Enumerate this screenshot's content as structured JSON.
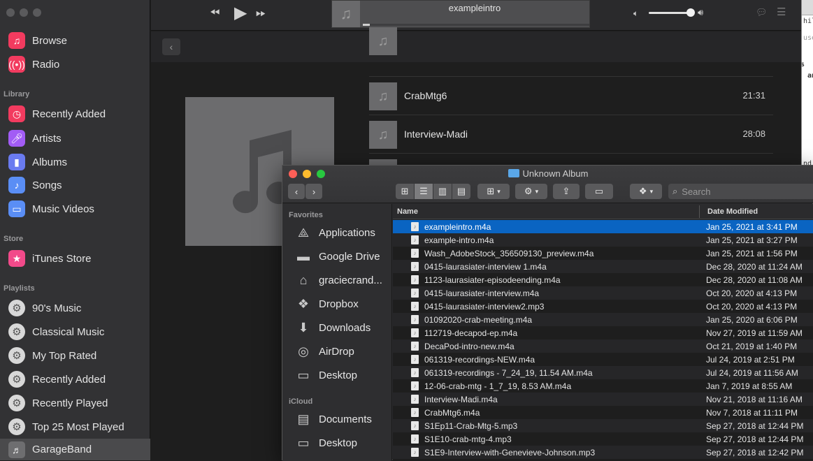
{
  "music": {
    "sidebar": {
      "top_items": [
        {
          "label": "Browse",
          "icon": "music-note-icon"
        },
        {
          "label": "Radio",
          "icon": "radio-waves-icon"
        }
      ],
      "library_heading": "Library",
      "library_items": [
        {
          "label": "Recently Added",
          "icon": "clock-icon"
        },
        {
          "label": "Artists",
          "icon": "microphone-icon"
        },
        {
          "label": "Albums",
          "icon": "album-stack-icon"
        },
        {
          "label": "Songs",
          "icon": "music-note-icon"
        },
        {
          "label": "Music Videos",
          "icon": "video-icon"
        }
      ],
      "store_heading": "Store",
      "store_items": [
        {
          "label": "iTunes Store",
          "icon": "star-icon"
        }
      ],
      "playlists_heading": "Playlists",
      "playlist_items": [
        {
          "label": "90's Music",
          "icon": "smart-playlist-gear-icon"
        },
        {
          "label": "Classical Music",
          "icon": "smart-playlist-gear-icon"
        },
        {
          "label": "My Top Rated",
          "icon": "smart-playlist-gear-icon"
        },
        {
          "label": "Recently Added",
          "icon": "smart-playlist-gear-icon"
        },
        {
          "label": "Recently Played",
          "icon": "smart-playlist-gear-icon"
        },
        {
          "label": "Top 25 Most Played",
          "icon": "smart-playlist-gear-icon"
        },
        {
          "label": "GarageBand",
          "icon": "playlist-icon",
          "selected": true
        }
      ]
    },
    "now_playing": {
      "title": "exampleintro",
      "progress": 0.03
    },
    "volume": 0.9,
    "tracks": [
      {
        "name": "CrabMtg6",
        "time": "21:31"
      },
      {
        "name": "Interview-Madi",
        "time": "28:08"
      }
    ]
  },
  "finder": {
    "title": "Unknown Album",
    "search_placeholder": "Search",
    "favorites_heading": "Favorites",
    "favorites": [
      {
        "label": "Applications",
        "icon": "applications-icon"
      },
      {
        "label": "Google Drive",
        "icon": "folder-icon"
      },
      {
        "label": "graciecrand...",
        "icon": "home-icon"
      },
      {
        "label": "Dropbox",
        "icon": "dropbox-icon"
      },
      {
        "label": "Downloads",
        "icon": "downloads-icon"
      },
      {
        "label": "AirDrop",
        "icon": "airdrop-icon"
      },
      {
        "label": "Desktop",
        "icon": "desktop-icon"
      }
    ],
    "icloud_heading": "iCloud",
    "icloud": [
      {
        "label": "Documents",
        "icon": "documents-icon"
      },
      {
        "label": "Desktop",
        "icon": "desktop-icon"
      }
    ],
    "columns": {
      "name": "Name",
      "date": "Date Modified"
    },
    "files": [
      {
        "name": "exampleintro.m4a",
        "date": "Jan 25, 2021 at 3:41 PM",
        "selected": true
      },
      {
        "name": "example-intro.m4a",
        "date": "Jan 25, 2021 at 3:27 PM"
      },
      {
        "name": "Wash_AdobeStock_356509130_preview.m4a",
        "date": "Jan 25, 2021 at 1:56 PM"
      },
      {
        "name": "0415-laurasiater-interview 1.m4a",
        "date": "Dec 28, 2020 at 11:24 AM"
      },
      {
        "name": "1123-laurasiater-episodeending.m4a",
        "date": "Dec 28, 2020 at 11:08 AM"
      },
      {
        "name": "0415-laurasiater-interview.m4a",
        "date": "Oct 20, 2020 at 4:13 PM"
      },
      {
        "name": "0415-laurasiater-interview2.mp3",
        "date": "Oct 20, 2020 at 4:13 PM"
      },
      {
        "name": "01092020-crab-meeting.m4a",
        "date": "Jan 25, 2020 at 6:06 PM"
      },
      {
        "name": "112719-decapod-ep.m4a",
        "date": "Nov 27, 2019 at 11:59 AM"
      },
      {
        "name": "DecaPod-intro-new.m4a",
        "date": "Oct 21, 2019 at 1:40 PM"
      },
      {
        "name": "061319-recordings-NEW.m4a",
        "date": "Jul 24, 2019 at 2:51 PM"
      },
      {
        "name": "061319-recordings - 7_24_19, 11.54 AM.m4a",
        "date": "Jul 24, 2019 at 11:56 AM"
      },
      {
        "name": "12-06-crab-mtg - 1_7_19, 8.53 AM.m4a",
        "date": "Jan 7, 2019 at 8:55 AM"
      },
      {
        "name": "Interview-Madi.m4a",
        "date": "Nov 21, 2018 at 11:16 AM"
      },
      {
        "name": "CrabMtg6.m4a",
        "date": "Nov 7, 2018 at 11:11 PM"
      },
      {
        "name": "S1Ep11-Crab-Mtg-5.mp3",
        "date": "Sep 27, 2018 at 12:44 PM"
      },
      {
        "name": "S1E10-crab-mtg-4.mp3",
        "date": "Sep 27, 2018 at 12:44 PM"
      },
      {
        "name": "S1E9-Interview-with-Genevieve-Johnson.mp3",
        "date": "Sep 27, 2018 at 12:42 PM"
      }
    ]
  },
  "terminal": {
    "lines": [
      "hild",
      "use",
      "s ",
      "an",
      "nd"
    ]
  }
}
